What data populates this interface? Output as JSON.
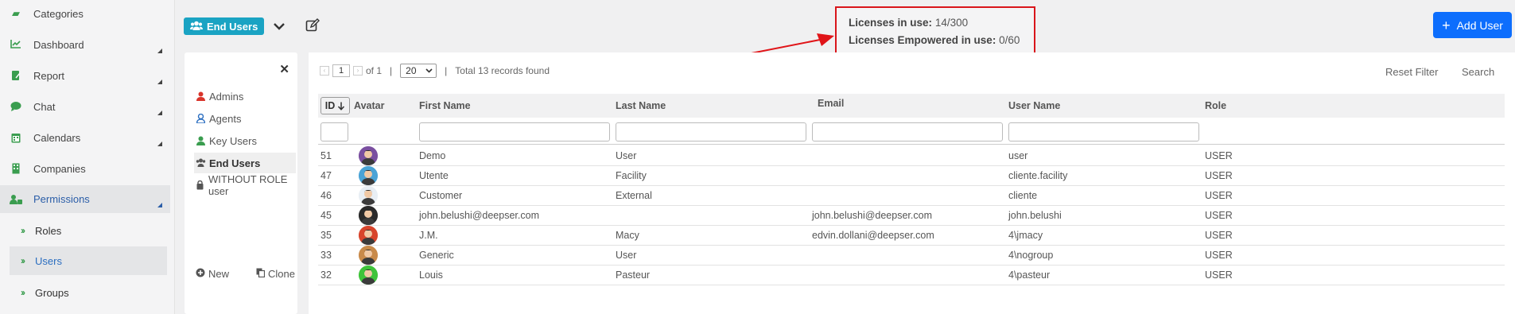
{
  "sidebar": {
    "items": [
      {
        "label": "Categories",
        "icon": "folder-open-icon"
      },
      {
        "label": "Dashboard",
        "icon": "chart-line-icon"
      },
      {
        "label": "Report",
        "icon": "file-edit-icon"
      },
      {
        "label": "Chat",
        "icon": "comment-icon"
      },
      {
        "label": "Calendars",
        "icon": "calendar-icon"
      },
      {
        "label": "Companies",
        "icon": "building-icon"
      },
      {
        "label": "Permissions",
        "icon": "user-lock-icon"
      }
    ],
    "subitems": [
      {
        "label": "Roles"
      },
      {
        "label": "Users"
      },
      {
        "label": "Groups"
      }
    ]
  },
  "header": {
    "badge_label": "End Users"
  },
  "licenses": {
    "in_use_label": "Licenses in use:",
    "in_use_value": "14/300",
    "empowered_label": "Licenses Empowered in use:",
    "empowered_value": "0/60"
  },
  "add_user_label": "Add User",
  "filter_panel": {
    "items": [
      {
        "label": "Admins",
        "color": "#d9342b"
      },
      {
        "label": "Agents",
        "color": "#2b6ec0"
      },
      {
        "label": "Key Users",
        "color": "#3a9d4f"
      },
      {
        "label": "End Users",
        "color": "#555555"
      },
      {
        "label": "WITHOUT ROLE user",
        "color": "#555555"
      }
    ],
    "new_label": "New",
    "clone_label": "Clone"
  },
  "pager": {
    "page": "1",
    "of_label": "of 1",
    "page_size": "20",
    "records_label": "Total 13 records found",
    "reset_filter": "Reset Filter",
    "search": "Search"
  },
  "table": {
    "headers": {
      "id": "ID",
      "avatar": "Avatar",
      "first_name": "First Name",
      "last_name": "Last Name",
      "email": "Email",
      "user_name": "User Name",
      "role": "Role"
    },
    "rows": [
      {
        "id": "51",
        "first": "Demo",
        "last": "User",
        "email": "",
        "user": "user",
        "role": "USER",
        "avatar_color": "#7a4fa0"
      },
      {
        "id": "47",
        "first": "Utente",
        "last": "Facility",
        "email": "",
        "user": "cliente.facility",
        "role": "USER",
        "avatar_color": "#4aa3d6"
      },
      {
        "id": "46",
        "first": "Customer",
        "last": "External",
        "email": "",
        "user": "cliente",
        "role": "USER",
        "avatar_color": "#e8eef4"
      },
      {
        "id": "45",
        "first": "john.belushi@deepser.com",
        "last": "",
        "email": "john.belushi@deepser.com",
        "user": "john.belushi",
        "role": "USER",
        "avatar_color": "#2a2a2a"
      },
      {
        "id": "35",
        "first": "J.M.",
        "last": "Macy",
        "email": "edvin.dollani@deepser.com",
        "user": "4\\jmacy",
        "role": "USER",
        "avatar_color": "#d8452c"
      },
      {
        "id": "33",
        "first": "Generic",
        "last": "User",
        "email": "",
        "user": "4\\nogroup",
        "role": "USER",
        "avatar_color": "#c98a4a"
      },
      {
        "id": "32",
        "first": "Louis",
        "last": "Pasteur",
        "email": "",
        "user": "4\\pasteur",
        "role": "USER",
        "avatar_color": "#3fc43a"
      }
    ]
  }
}
